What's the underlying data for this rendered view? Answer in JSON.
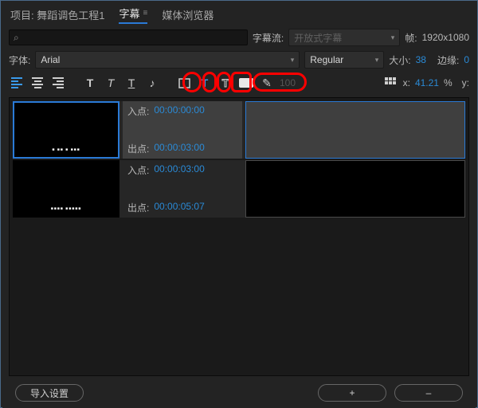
{
  "tabs": {
    "project_label": "项目: 舞蹈调色工程1",
    "captions_label": "字幕",
    "media_browser_label": "媒体浏览器"
  },
  "search": {
    "placeholder": "⌕"
  },
  "stream": {
    "label": "字幕流:",
    "value": "开放式字幕"
  },
  "frame": {
    "label": "帧:",
    "value": "1920x1080"
  },
  "font": {
    "label": "字体:",
    "family": "Arial",
    "style": "Regular",
    "size_label": "大小:",
    "size": "38",
    "edge_label": "边缘:",
    "edge": "0"
  },
  "toolbar": {
    "opacity": "100",
    "x_label": "x:",
    "x_value": "41.21",
    "percent": "%",
    "y_label": "y:"
  },
  "clips": {
    "in_label": "入点:",
    "out_label": "出点:",
    "rows": [
      {
        "in": "00:00:00:00",
        "out": "00:00:03:00"
      },
      {
        "in": "00:00:03:00",
        "out": "00:00:05:07"
      }
    ]
  },
  "footer": {
    "import_settings": "导入设置",
    "plus": "+",
    "minus": "–"
  }
}
